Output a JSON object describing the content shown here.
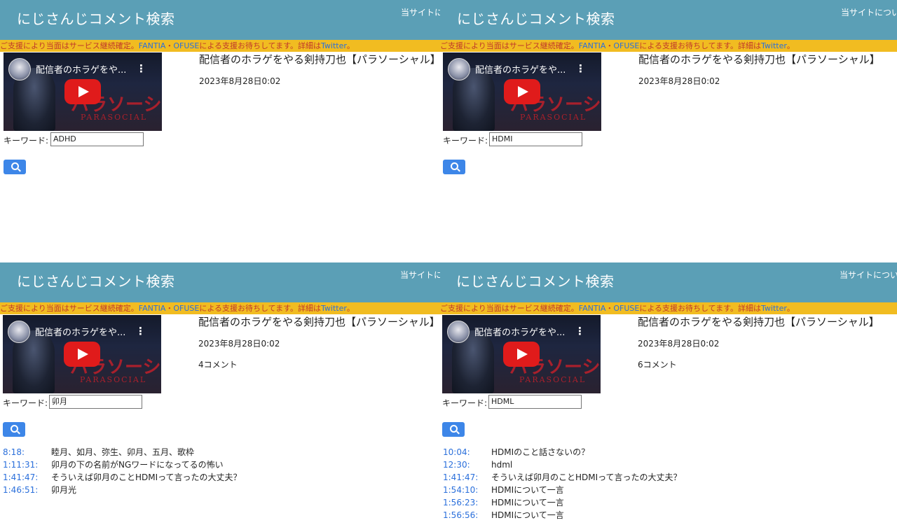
{
  "site": {
    "title": "にじさんじコメント検索",
    "notice": "当サイトについて",
    "banner": {
      "prefix": "ご支援により当面はサービス継続確定。",
      "fantia": "FANTIA",
      "sep": "・",
      "ofuse": "OFUSE",
      "mid": "による支援お待ちしてます。詳細は",
      "twitter": "Twitter",
      "end": "。"
    }
  },
  "video": {
    "title": "配信者のホラゲをやる剣持刀也【パラソーシャル】",
    "thumb_title": "配信者のホラゲをや...",
    "thumb_bg_text": "パラソーシャル",
    "thumb_bg_sub": "PARASOCIAL",
    "date": "2023年8月28日0:02"
  },
  "labels": {
    "keyword": "キーワード:",
    "colon": ":"
  },
  "panels": [
    {
      "keyword": "ADHD",
      "count": "",
      "results": []
    },
    {
      "keyword": "HDMI",
      "count": "",
      "results": []
    },
    {
      "keyword": "卯月",
      "count": "4コメント",
      "results": [
        {
          "time": "8:18",
          "text": "睦月、如月、弥生、卯月、五月、歌枠"
        },
        {
          "time": "1:11:31",
          "text": "卯月の下の名前がNGワードになってるの怖い"
        },
        {
          "time": "1:41:47",
          "text": "そういえば卯月のことHDMIって言ったの大丈夫？"
        },
        {
          "time": "1:46:51",
          "text": "卯月光"
        }
      ]
    },
    {
      "keyword": "HDML",
      "count": "6コメント",
      "results": [
        {
          "time": "10:04",
          "text": "HDMIのこと話さないの？"
        },
        {
          "time": "12:30",
          "text": "hdml"
        },
        {
          "time": "1:41:47",
          "text": "そういえば卯月のことHDMIって言ったの大丈夫？"
        },
        {
          "time": "1:54:10",
          "text": "HDMIについて一言"
        },
        {
          "time": "1:56:23",
          "text": "HDMIについて一言"
        },
        {
          "time": "1:56:56",
          "text": "HDMIについて一言"
        }
      ]
    }
  ],
  "colors": {
    "header": "#5b9fb6",
    "banner": "#f1bc21",
    "accent": "#3d86e8",
    "link": "#2a6fdb"
  },
  "icons": {
    "search": "search-icon",
    "play": "youtube-play-icon",
    "menu": "kebab-menu-icon"
  }
}
